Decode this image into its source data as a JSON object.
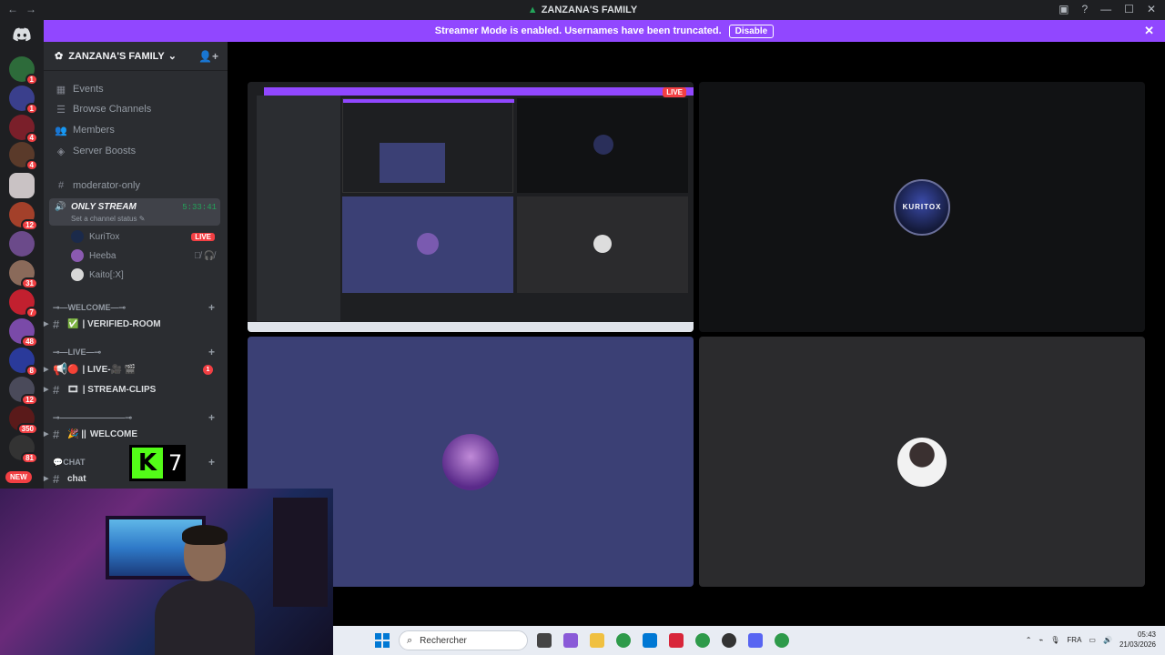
{
  "window": {
    "title": "ZANZANA'S FAMILY",
    "back": "←",
    "forward": "→"
  },
  "banner": {
    "text": "Streamer Mode is enabled. Usernames have been truncated.",
    "button": "Disable",
    "close": "✕"
  },
  "guild_badges": [
    "1",
    "1",
    "4",
    "4",
    "",
    "12",
    "",
    "31",
    "7",
    "48",
    "8",
    "12",
    "350",
    "81"
  ],
  "new_pill": "NEW",
  "server": {
    "name": "ZANZANA'S FAMILY",
    "menu": [
      {
        "label": "Events",
        "icon": "calendar-icon"
      },
      {
        "label": "Browse Channels",
        "icon": "browse-icon"
      },
      {
        "label": "Members",
        "icon": "members-icon"
      },
      {
        "label": "Server Boosts",
        "icon": "boost-icon"
      }
    ],
    "moderator_channel": "moderator-only",
    "voice_channel": {
      "name": "ONLY STREAM",
      "time": "5:33:41",
      "status": "Set a channel status"
    },
    "voice_users": [
      {
        "name": "KuriTox",
        "live": "LIVE"
      },
      {
        "name": "Heeba",
        "live": ""
      },
      {
        "name": "Kaito[:X]",
        "live": ""
      }
    ],
    "categories": [
      {
        "label": "⊸—WELCOME—⊸",
        "channels": [
          {
            "name": "| VERIFIED-ROOM",
            "prefix": "✅",
            "badge": ""
          }
        ]
      },
      {
        "label": "⊸—LIVE—⊸",
        "channels": [
          {
            "name": "| LIVE-🎥 🎬",
            "prefix": "🔴",
            "badge": "1"
          },
          {
            "name": "| STREAM-CLIPS",
            "prefix": "🎞",
            "badge": ""
          }
        ]
      },
      {
        "label": "⊸————————⊸",
        "channels": [
          {
            "name": "WELCOME",
            "prefix": "🎉 ||",
            "badge": ""
          }
        ]
      },
      {
        "label": "CHAT",
        "channels": [
          {
            "name": "chat",
            "prefix": "",
            "badge": ""
          }
        ]
      }
    ]
  },
  "stage": {
    "live_tag": "LIVE",
    "kuritox_logo": "KURITOX"
  },
  "overlay": {
    "kick_number": "7"
  },
  "taskbar": {
    "search_placeholder": "Rechercher",
    "language": "FRA",
    "time": "05:43",
    "date": "21/03/2026"
  }
}
